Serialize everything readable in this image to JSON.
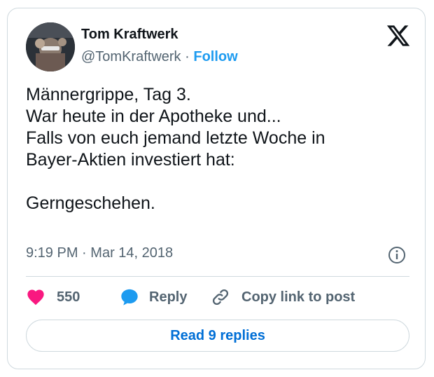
{
  "tweet": {
    "author_name": "Tom Kraftwerk",
    "handle": "@TomKraftwerk",
    "separator": "·",
    "follow_label": "Follow",
    "lines": [
      "Männergrippe, Tag 3.",
      "War heute in der Apotheke und...",
      "Falls von euch jemand letzte Woche in",
      "Bayer-Aktien investiert hat:",
      "",
      "Gerngeschehen."
    ],
    "time": "9:19 PM",
    "date": "Mar 14, 2018",
    "likes": "550",
    "reply_label": "Reply",
    "copy_label": "Copy link to post",
    "read_replies_label": "Read 9 replies"
  },
  "icons": {
    "logo": "x-logo-icon",
    "info": "info-icon",
    "like": "heart-icon",
    "reply": "speech-bubble-icon",
    "copy": "link-icon"
  },
  "colors": {
    "text": "#0f1419",
    "secondary": "#536471",
    "accent": "#1d9bf0",
    "like": "#f91880",
    "border": "#cfd9de"
  }
}
